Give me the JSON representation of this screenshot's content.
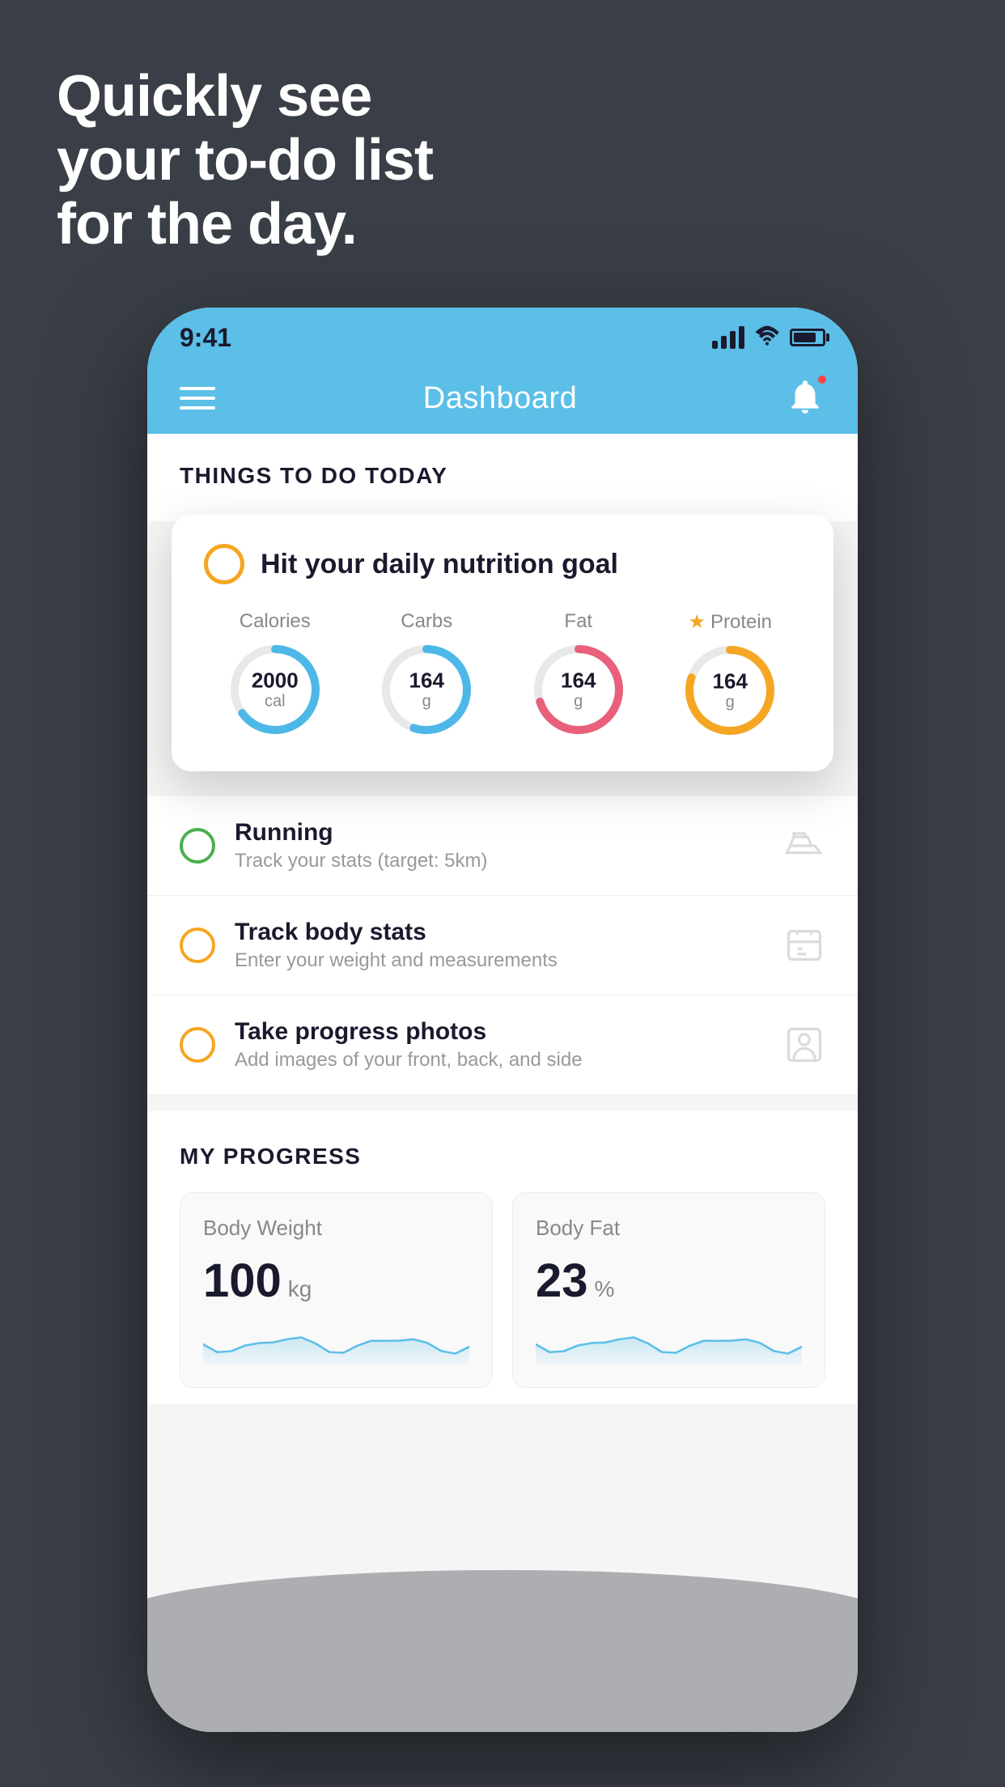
{
  "hero": {
    "line1": "Quickly see",
    "line2": "your to-do list",
    "line3": "for the day."
  },
  "status_bar": {
    "time": "9:41"
  },
  "nav": {
    "title": "Dashboard"
  },
  "things_section": {
    "title": "THINGS TO DO TODAY"
  },
  "floating_card": {
    "title": "Hit your daily nutrition goal",
    "nutrients": [
      {
        "label": "Calories",
        "value": "2000",
        "unit": "cal",
        "color": "#4db8e8",
        "track_pct": 65,
        "star": false
      },
      {
        "label": "Carbs",
        "value": "164",
        "unit": "g",
        "color": "#4db8e8",
        "track_pct": 55,
        "star": false
      },
      {
        "label": "Fat",
        "value": "164",
        "unit": "g",
        "color": "#e8607a",
        "track_pct": 70,
        "star": false
      },
      {
        "label": "Protein",
        "value": "164",
        "unit": "g",
        "color": "#f5a623",
        "track_pct": 80,
        "star": true
      }
    ]
  },
  "list_items": [
    {
      "title": "Running",
      "sub": "Track your stats (target: 5km)",
      "circle": "green",
      "icon": "shoe"
    },
    {
      "title": "Track body stats",
      "sub": "Enter your weight and measurements",
      "circle": "yellow",
      "icon": "scale"
    },
    {
      "title": "Take progress photos",
      "sub": "Add images of your front, back, and side",
      "circle": "yellow",
      "icon": "person"
    }
  ],
  "progress": {
    "title": "MY PROGRESS",
    "cards": [
      {
        "title": "Body Weight",
        "value": "100",
        "unit": "kg"
      },
      {
        "title": "Body Fat",
        "value": "23",
        "unit": "%"
      }
    ]
  }
}
